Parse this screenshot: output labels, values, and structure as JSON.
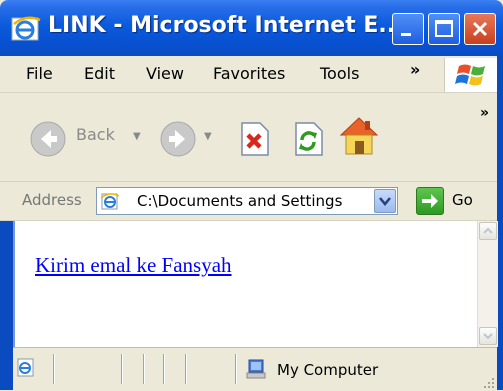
{
  "window": {
    "title": "LINK - Microsoft Internet E..."
  },
  "menu": {
    "items": [
      "File",
      "Edit",
      "View",
      "Favorites",
      "Tools"
    ],
    "overflow": "»"
  },
  "toolbar": {
    "back_label": "Back",
    "overflow": "»",
    "icons": [
      "back-icon",
      "forward-icon",
      "stop-icon",
      "refresh-icon",
      "home-icon"
    ]
  },
  "address": {
    "label": "Address",
    "value": "C:\\Documents and Settings",
    "go_label": "Go"
  },
  "content": {
    "link_text": "Kirim emal ke Fansyah"
  },
  "status": {
    "zone_text": "My Computer"
  },
  "colors": {
    "titlebar": "#0a5bdc",
    "link": "#0000ff",
    "chrome": "#ece9d8"
  }
}
